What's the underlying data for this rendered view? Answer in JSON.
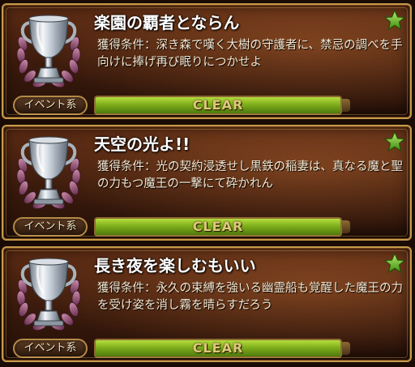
{
  "achievements": [
    {
      "title": "楽園の覇者とならん",
      "description": "獲得条件：深き森で嘆く大樹の守護者に、禁忌の調べを手向けに捧げ再び眠りにつかせよ",
      "category": "イベント系",
      "status": "CLEAR",
      "progress": 1.0,
      "icons": {
        "trophy": "silver-trophy-laurel-icon",
        "star": "green-star-icon"
      }
    },
    {
      "title": "天空の光よ!!",
      "description": "獲得条件：光の契約浸透せし黒鉄の稲妻は、真なる魔と聖の力もつ魔王の一撃にて砕かれん",
      "category": "イベント系",
      "status": "CLEAR",
      "progress": 1.0,
      "icons": {
        "trophy": "silver-trophy-laurel-icon",
        "star": "green-star-icon"
      }
    },
    {
      "title": "長き夜を楽しむもいい",
      "description": "獲得条件：永久の束縛を強いる幽霊船も覚醒した魔王の力を受け姿を消し霧を晴らすだろう",
      "category": "イベント系",
      "status": "CLEAR",
      "progress": 1.0,
      "icons": {
        "trophy": "silver-trophy-laurel-icon",
        "star": "green-star-icon"
      }
    }
  ],
  "colors": {
    "card_border": "#c79a4a",
    "bar_fill": "#7fae1c",
    "clear_text": "#dbc87a",
    "star": "#5fb32a"
  }
}
